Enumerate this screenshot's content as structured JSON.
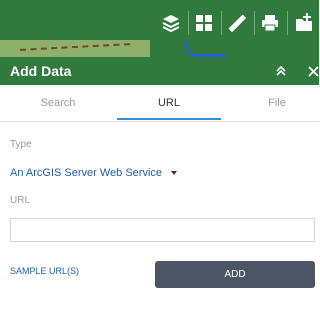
{
  "panel": {
    "title": "Add Data",
    "header_color": "#2f7a3c",
    "collapse_icon": "double-chevron-up-icon",
    "close_icon": "close-icon"
  },
  "toolbar": {
    "tools": [
      {
        "name": "layers-icon"
      },
      {
        "name": "basemap-gallery-icon"
      },
      {
        "name": "measure-icon"
      },
      {
        "name": "print-icon"
      },
      {
        "name": "add-data-icon"
      }
    ]
  },
  "tabs": [
    {
      "label": "Search",
      "active": false
    },
    {
      "label": "URL",
      "active": true
    },
    {
      "label": "File",
      "active": false
    }
  ],
  "form": {
    "type_label": "Type",
    "type_value": "An ArcGIS Server Web Service",
    "url_label": "URL",
    "url_value": "",
    "sample_link": "SAMPLE URL(S)",
    "add_button": "ADD"
  },
  "colors": {
    "accent": "#2d90d9",
    "link": "#1f5fa8",
    "button": "#4b5563"
  }
}
